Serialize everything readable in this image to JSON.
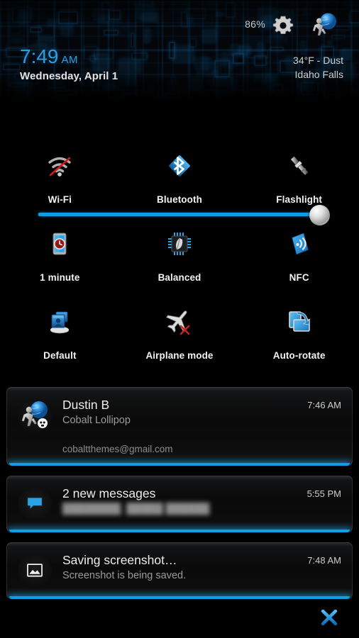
{
  "header": {
    "battery_percent": "86%",
    "gear_icon": "gear-icon",
    "avatar_icon": "user-avatar-icon",
    "time": "7:49",
    "time_ampm": "AM",
    "date": "Wednesday, April 1",
    "weather_temp": "34°F - Dust",
    "weather_location": "Idaho Falls",
    "accent_color": "#0d9ee6",
    "time_color": "#2b9fe0"
  },
  "brightness": {
    "name": "brightness-slider",
    "value_percent": 96
  },
  "tiles": [
    {
      "label": "Wi-Fi",
      "icon": "wifi-off-icon",
      "name": "tile-wifi"
    },
    {
      "label": "Bluetooth",
      "icon": "bluetooth-icon",
      "name": "tile-bluetooth"
    },
    {
      "label": "Flashlight",
      "icon": "flashlight-icon",
      "name": "tile-flashlight"
    },
    {
      "label": "1 minute",
      "icon": "screen-timeout-icon",
      "name": "tile-screen-timeout"
    },
    {
      "label": "Balanced",
      "icon": "cpu-leaf-icon",
      "name": "tile-performance-profile"
    },
    {
      "label": "NFC",
      "icon": "nfc-icon",
      "name": "tile-nfc"
    },
    {
      "label": "Default",
      "icon": "user-profile-icon",
      "name": "tile-profile"
    },
    {
      "label": "Airplane mode",
      "icon": "airplane-off-icon",
      "name": "tile-airplane-mode"
    },
    {
      "label": "Auto-rotate",
      "icon": "auto-rotate-icon",
      "name": "tile-auto-rotate"
    }
  ],
  "notifications": [
    {
      "title": "Dustin B",
      "subtitle": "Cobalt Lollipop",
      "time": "7:46 AM",
      "extra": "cobaltthemes@gmail.com",
      "icon": "user-avatar-icon",
      "name": "notification-email"
    },
    {
      "title": "2 new messages",
      "subtitle": "████████, █████ ██████",
      "time": "5:55 PM",
      "extra": "",
      "icon": "message-bubble-icon",
      "name": "notification-messages"
    },
    {
      "title": "Saving screenshot…",
      "subtitle": "Screenshot is being saved.",
      "time": "7:48 AM",
      "extra": "",
      "icon": "image-icon",
      "name": "notification-screenshot"
    }
  ],
  "close_button": {
    "name": "clear-all-notifications-button",
    "icon": "close-x-icon"
  }
}
